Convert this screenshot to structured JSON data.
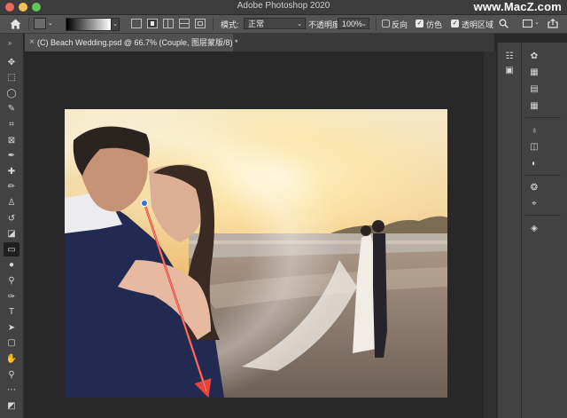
{
  "app": {
    "title": "Adobe Photoshop 2020",
    "watermark": "www.MacZ.com"
  },
  "options_bar": {
    "mode_label": "模式:",
    "mode_value": "正常",
    "opacity_label": "不透明度:",
    "opacity_value": "100%",
    "reverse_label": "反向",
    "reverse_checked": false,
    "dither_label": "仿色",
    "dither_checked": true,
    "transparency_label": "透明区域",
    "transparency_checked": true,
    "gradient_types": [
      "linear",
      "radial",
      "angle",
      "reflected",
      "diamond"
    ],
    "active_gradient_type": "radial"
  },
  "document_tab": {
    "close_glyph": "×",
    "title": "(C) Beach Wedding.psd @ 66.7% (Couple, 图层蒙版/8) *"
  },
  "tools": [
    {
      "name": "move-tool",
      "glyph": "✥"
    },
    {
      "name": "marquee-tool",
      "glyph": "⬚"
    },
    {
      "name": "lasso-tool",
      "glyph": "◯"
    },
    {
      "name": "quick-select-tool",
      "glyph": "✎"
    },
    {
      "name": "crop-tool",
      "glyph": "⌗"
    },
    {
      "name": "frame-tool",
      "glyph": "⊠"
    },
    {
      "name": "eyedropper-tool",
      "glyph": "✒"
    },
    {
      "name": "healing-brush-tool",
      "glyph": "✚"
    },
    {
      "name": "brush-tool",
      "glyph": "✏"
    },
    {
      "name": "clone-stamp-tool",
      "glyph": "♙"
    },
    {
      "name": "history-brush-tool",
      "glyph": "↺"
    },
    {
      "name": "eraser-tool",
      "glyph": "◪"
    },
    {
      "name": "gradient-tool",
      "glyph": "▭",
      "active": true
    },
    {
      "name": "blur-tool",
      "glyph": "●"
    },
    {
      "name": "dodge-tool",
      "glyph": "⚲"
    },
    {
      "name": "pen-tool",
      "glyph": "✑"
    },
    {
      "name": "type-tool",
      "glyph": "T"
    },
    {
      "name": "path-select-tool",
      "glyph": "➤"
    },
    {
      "name": "rectangle-tool",
      "glyph": "▢"
    },
    {
      "name": "hand-tool",
      "glyph": "✋"
    },
    {
      "name": "zoom-tool",
      "glyph": "⚲"
    },
    {
      "name": "more-tools",
      "glyph": "⋯"
    },
    {
      "name": "color-swatches",
      "glyph": "◩"
    }
  ],
  "panel_icons_strip": [
    "libraries-icon",
    "history-icon"
  ],
  "panel_icons_col": [
    "color-icon",
    "swatches-icon",
    "gradients-icon",
    "patterns-icon",
    "learn-icon",
    "libraries-panel-icon",
    "adjustments-icon",
    "styles-icon",
    "paths-icon",
    "layers-icon"
  ],
  "colors": {
    "accent": "#1473e6",
    "gradient_line": "#e8453a"
  }
}
